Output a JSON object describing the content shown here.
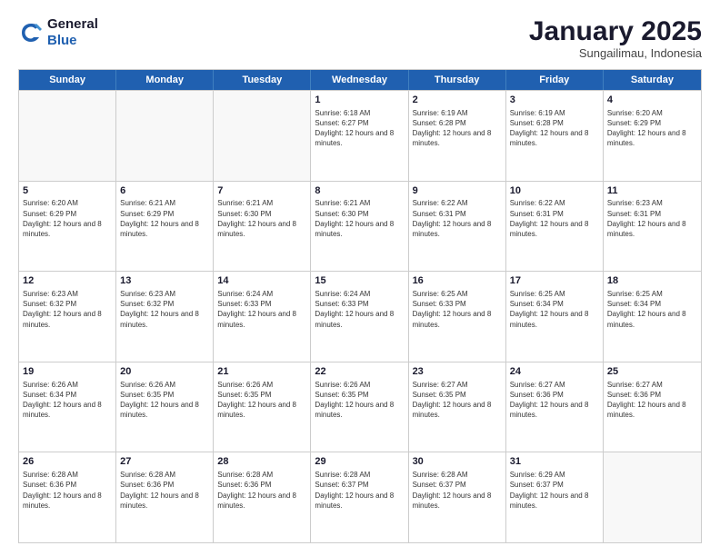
{
  "header": {
    "logo_line1": "General",
    "logo_line2": "Blue",
    "month": "January 2025",
    "location": "Sungailimau, Indonesia"
  },
  "days_of_week": [
    "Sunday",
    "Monday",
    "Tuesday",
    "Wednesday",
    "Thursday",
    "Friday",
    "Saturday"
  ],
  "weeks": [
    [
      {
        "day": "",
        "text": ""
      },
      {
        "day": "",
        "text": ""
      },
      {
        "day": "",
        "text": ""
      },
      {
        "day": "1",
        "text": "Sunrise: 6:18 AM\nSunset: 6:27 PM\nDaylight: 12 hours and 8 minutes."
      },
      {
        "day": "2",
        "text": "Sunrise: 6:19 AM\nSunset: 6:28 PM\nDaylight: 12 hours and 8 minutes."
      },
      {
        "day": "3",
        "text": "Sunrise: 6:19 AM\nSunset: 6:28 PM\nDaylight: 12 hours and 8 minutes."
      },
      {
        "day": "4",
        "text": "Sunrise: 6:20 AM\nSunset: 6:29 PM\nDaylight: 12 hours and 8 minutes."
      }
    ],
    [
      {
        "day": "5",
        "text": "Sunrise: 6:20 AM\nSunset: 6:29 PM\nDaylight: 12 hours and 8 minutes."
      },
      {
        "day": "6",
        "text": "Sunrise: 6:21 AM\nSunset: 6:29 PM\nDaylight: 12 hours and 8 minutes."
      },
      {
        "day": "7",
        "text": "Sunrise: 6:21 AM\nSunset: 6:30 PM\nDaylight: 12 hours and 8 minutes."
      },
      {
        "day": "8",
        "text": "Sunrise: 6:21 AM\nSunset: 6:30 PM\nDaylight: 12 hours and 8 minutes."
      },
      {
        "day": "9",
        "text": "Sunrise: 6:22 AM\nSunset: 6:31 PM\nDaylight: 12 hours and 8 minutes."
      },
      {
        "day": "10",
        "text": "Sunrise: 6:22 AM\nSunset: 6:31 PM\nDaylight: 12 hours and 8 minutes."
      },
      {
        "day": "11",
        "text": "Sunrise: 6:23 AM\nSunset: 6:31 PM\nDaylight: 12 hours and 8 minutes."
      }
    ],
    [
      {
        "day": "12",
        "text": "Sunrise: 6:23 AM\nSunset: 6:32 PM\nDaylight: 12 hours and 8 minutes."
      },
      {
        "day": "13",
        "text": "Sunrise: 6:23 AM\nSunset: 6:32 PM\nDaylight: 12 hours and 8 minutes."
      },
      {
        "day": "14",
        "text": "Sunrise: 6:24 AM\nSunset: 6:33 PM\nDaylight: 12 hours and 8 minutes."
      },
      {
        "day": "15",
        "text": "Sunrise: 6:24 AM\nSunset: 6:33 PM\nDaylight: 12 hours and 8 minutes."
      },
      {
        "day": "16",
        "text": "Sunrise: 6:25 AM\nSunset: 6:33 PM\nDaylight: 12 hours and 8 minutes."
      },
      {
        "day": "17",
        "text": "Sunrise: 6:25 AM\nSunset: 6:34 PM\nDaylight: 12 hours and 8 minutes."
      },
      {
        "day": "18",
        "text": "Sunrise: 6:25 AM\nSunset: 6:34 PM\nDaylight: 12 hours and 8 minutes."
      }
    ],
    [
      {
        "day": "19",
        "text": "Sunrise: 6:26 AM\nSunset: 6:34 PM\nDaylight: 12 hours and 8 minutes."
      },
      {
        "day": "20",
        "text": "Sunrise: 6:26 AM\nSunset: 6:35 PM\nDaylight: 12 hours and 8 minutes."
      },
      {
        "day": "21",
        "text": "Sunrise: 6:26 AM\nSunset: 6:35 PM\nDaylight: 12 hours and 8 minutes."
      },
      {
        "day": "22",
        "text": "Sunrise: 6:26 AM\nSunset: 6:35 PM\nDaylight: 12 hours and 8 minutes."
      },
      {
        "day": "23",
        "text": "Sunrise: 6:27 AM\nSunset: 6:35 PM\nDaylight: 12 hours and 8 minutes."
      },
      {
        "day": "24",
        "text": "Sunrise: 6:27 AM\nSunset: 6:36 PM\nDaylight: 12 hours and 8 minutes."
      },
      {
        "day": "25",
        "text": "Sunrise: 6:27 AM\nSunset: 6:36 PM\nDaylight: 12 hours and 8 minutes."
      }
    ],
    [
      {
        "day": "26",
        "text": "Sunrise: 6:28 AM\nSunset: 6:36 PM\nDaylight: 12 hours and 8 minutes."
      },
      {
        "day": "27",
        "text": "Sunrise: 6:28 AM\nSunset: 6:36 PM\nDaylight: 12 hours and 8 minutes."
      },
      {
        "day": "28",
        "text": "Sunrise: 6:28 AM\nSunset: 6:36 PM\nDaylight: 12 hours and 8 minutes."
      },
      {
        "day": "29",
        "text": "Sunrise: 6:28 AM\nSunset: 6:37 PM\nDaylight: 12 hours and 8 minutes."
      },
      {
        "day": "30",
        "text": "Sunrise: 6:28 AM\nSunset: 6:37 PM\nDaylight: 12 hours and 8 minutes."
      },
      {
        "day": "31",
        "text": "Sunrise: 6:29 AM\nSunset: 6:37 PM\nDaylight: 12 hours and 8 minutes."
      },
      {
        "day": "",
        "text": ""
      }
    ]
  ]
}
